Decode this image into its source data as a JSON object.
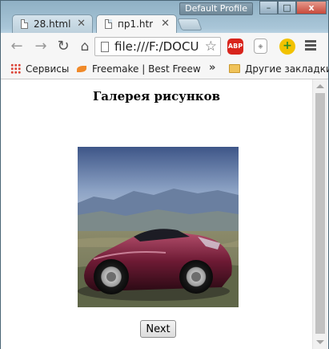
{
  "window": {
    "profile_label": "Default Profile",
    "controls": {
      "minimize": "–",
      "maximize": "□",
      "close": "x"
    }
  },
  "tabs": [
    {
      "label": "28.html",
      "active": false
    },
    {
      "label": "пр1.html",
      "active": true
    }
  ],
  "toolbar": {
    "url": "file:///F:/DOCU"
  },
  "extensions": [
    {
      "name": "adblock-plus-icon",
      "label": "ABP"
    },
    {
      "name": "shield-extension-icon",
      "label": ""
    },
    {
      "name": "plus-extension-icon",
      "label": "+"
    }
  ],
  "bookmarks": {
    "apps_label": "Сервисы",
    "freemake_label": "Freemake | Best Freew",
    "more_label": "»",
    "other_label": "Другие закладки"
  },
  "page": {
    "title": "Галерея рисунков",
    "image_alt": "car photo",
    "next_label": "Next"
  }
}
